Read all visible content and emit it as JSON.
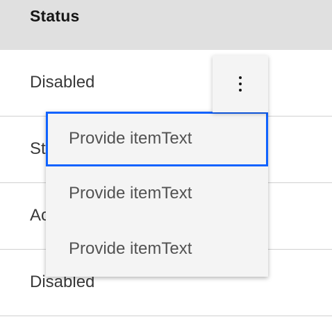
{
  "table": {
    "column_header": "Status",
    "rows": [
      {
        "status": "Disabled"
      },
      {
        "status": "St"
      },
      {
        "status": "Ac"
      },
      {
        "status": "Disabled"
      }
    ]
  },
  "overflow_menu": {
    "trigger_icon": "overflow-menu-vertical-icon",
    "focus_color": "#0f62fe",
    "items": [
      {
        "label": "Provide itemText",
        "focused": true
      },
      {
        "label": "Provide itemText",
        "focused": false
      },
      {
        "label": "Provide itemText",
        "focused": false
      }
    ]
  }
}
